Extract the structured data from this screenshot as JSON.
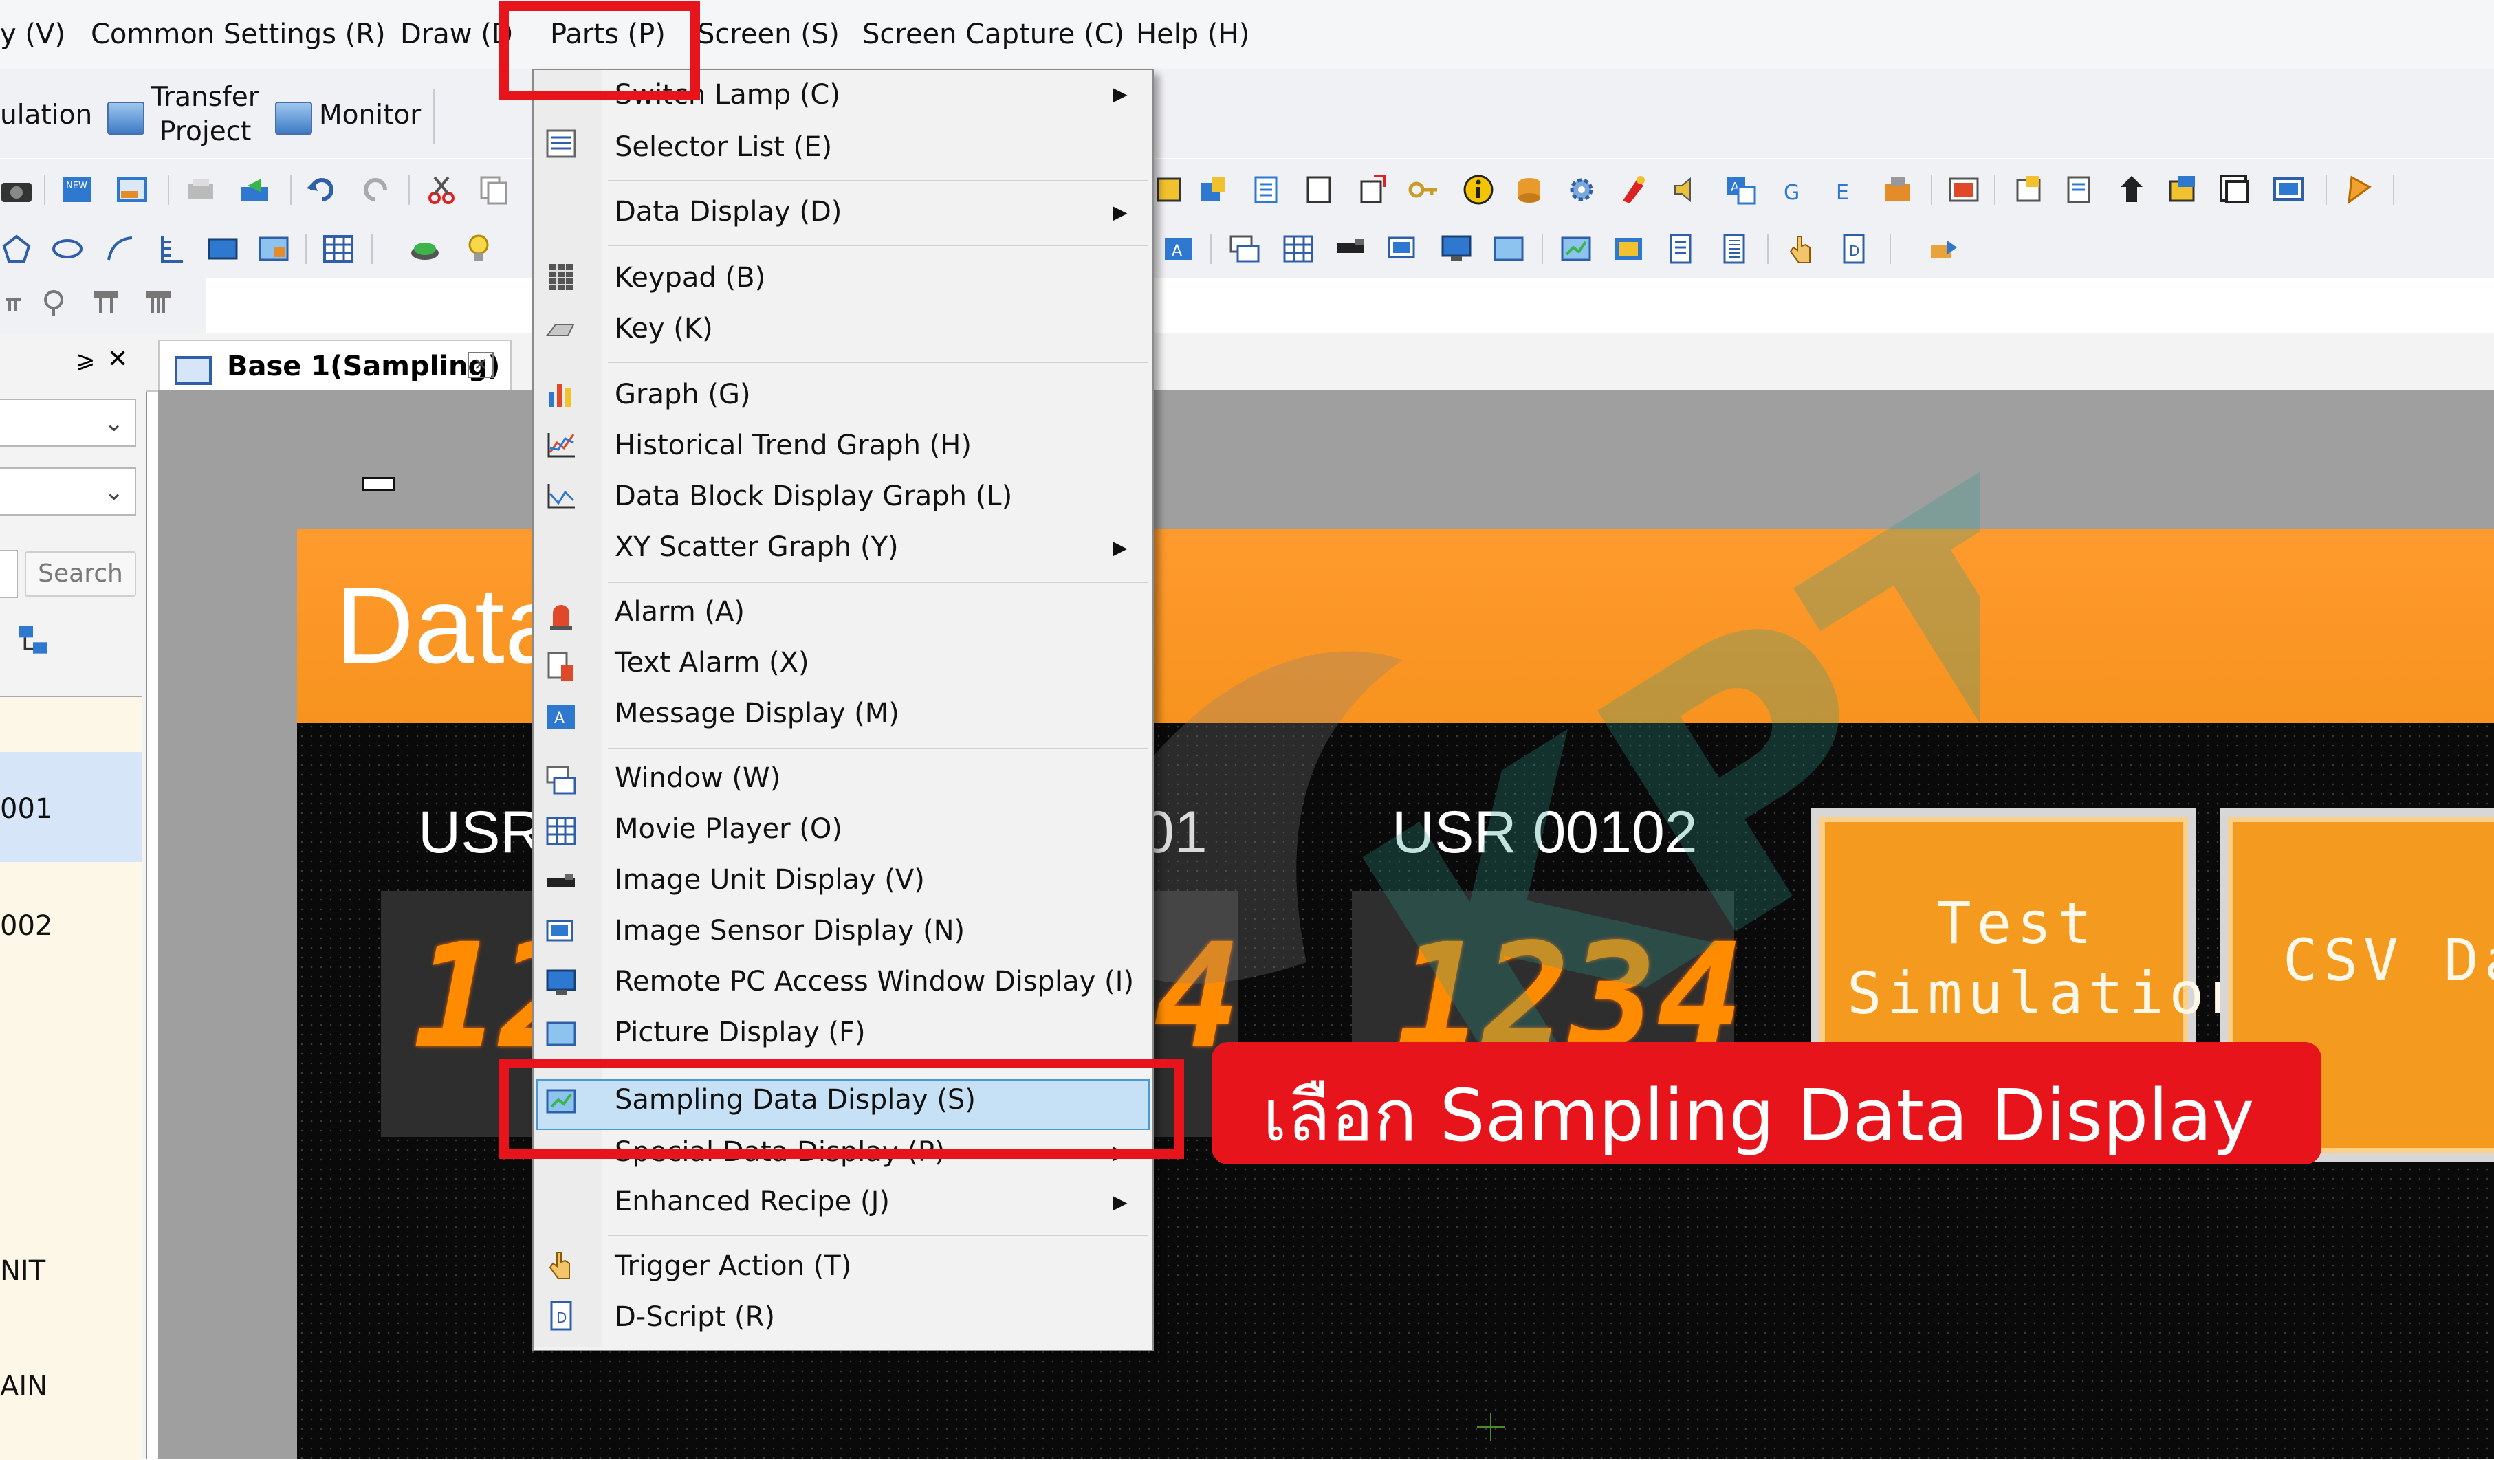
{
  "menubar": {
    "items": [
      {
        "label": "y (V)"
      },
      {
        "label": "Common Settings (R)"
      },
      {
        "label": "Draw (D"
      },
      {
        "label": "Parts (P)"
      },
      {
        "label": "Screen (S)"
      },
      {
        "label": "Screen Capture (C)"
      },
      {
        "label": "Help (H)"
      }
    ]
  },
  "quickbar": {
    "simulation": "ulation",
    "transfer_line1": "Transfer",
    "transfer_line2": "Project",
    "monitor": "Monitor"
  },
  "leftpanel": {
    "search_label": "Search",
    "pin": "⩾",
    "close": "✕",
    "list_items": [
      "001",
      "002",
      "NIT",
      "AIN"
    ]
  },
  "tab": {
    "title": "Base 1(Sampling)",
    "close": "✕"
  },
  "screen": {
    "title": "Data",
    "usr_labels": [
      "USR",
      "01",
      "USR 00102"
    ],
    "seg_values": [
      "12",
      "4",
      "1234"
    ],
    "buttons": [
      {
        "line1": "Test",
        "line2": "Simulation"
      },
      {
        "line1": "CSV Dat",
        "line2": ""
      }
    ]
  },
  "parts_menu": {
    "items": [
      {
        "label": "Switch Lamp (C)",
        "submenu": true,
        "icon": "switch-lamp-icon"
      },
      {
        "label": "Selector List (E)",
        "submenu": false,
        "icon": "selector-list-icon"
      },
      {
        "label": "Data Display (D)",
        "submenu": true,
        "icon": "data-display-icon"
      },
      {
        "label": "Keypad (B)",
        "submenu": false,
        "icon": "keypad-icon"
      },
      {
        "label": "Key (K)",
        "submenu": false,
        "icon": "key-icon"
      },
      {
        "label": "Graph (G)",
        "submenu": false,
        "icon": "graph-icon"
      },
      {
        "label": "Historical Trend Graph (H)",
        "submenu": false,
        "icon": "historical-trend-icon"
      },
      {
        "label": "Data Block Display Graph (L)",
        "submenu": false,
        "icon": "data-block-graph-icon"
      },
      {
        "label": "XY Scatter Graph (Y)",
        "submenu": true,
        "icon": "xy-scatter-icon"
      },
      {
        "label": "Alarm (A)",
        "submenu": false,
        "icon": "alarm-icon"
      },
      {
        "label": "Text Alarm (X)",
        "submenu": false,
        "icon": "text-alarm-icon"
      },
      {
        "label": "Message Display (M)",
        "submenu": false,
        "icon": "message-display-icon"
      },
      {
        "label": "Window (W)",
        "submenu": false,
        "icon": "window-icon"
      },
      {
        "label": "Movie Player (O)",
        "submenu": false,
        "icon": "movie-player-icon"
      },
      {
        "label": "Image Unit Display (V)",
        "submenu": false,
        "icon": "image-unit-icon"
      },
      {
        "label": "Image Sensor Display (N)",
        "submenu": false,
        "icon": "image-sensor-icon"
      },
      {
        "label": "Remote PC Access Window Display (I)",
        "submenu": false,
        "icon": "remote-pc-icon"
      },
      {
        "label": "Picture Display (F)",
        "submenu": false,
        "icon": "picture-display-icon"
      },
      {
        "label": "Sampling Data Display (S)",
        "submenu": false,
        "icon": "sampling-data-icon",
        "highlighted": true
      },
      {
        "label": "Special Data Display (P)",
        "submenu": true,
        "icon": "special-data-icon"
      },
      {
        "label": "Enhanced Recipe (J)",
        "submenu": true,
        "icon": "enhanced-recipe-icon"
      },
      {
        "label": "Trigger Action (T)",
        "submenu": false,
        "icon": "trigger-action-icon"
      },
      {
        "label": "D-Script (R)",
        "submenu": false,
        "icon": "d-script-icon"
      }
    ]
  },
  "callout": {
    "text": "เลือก Sampling Data Display"
  },
  "colors": {
    "accent_red": "#e8141c",
    "screen_orange": "#f7931e",
    "menu_highlight": "#c6e0f6",
    "segment_orange": "#ff8c00"
  }
}
